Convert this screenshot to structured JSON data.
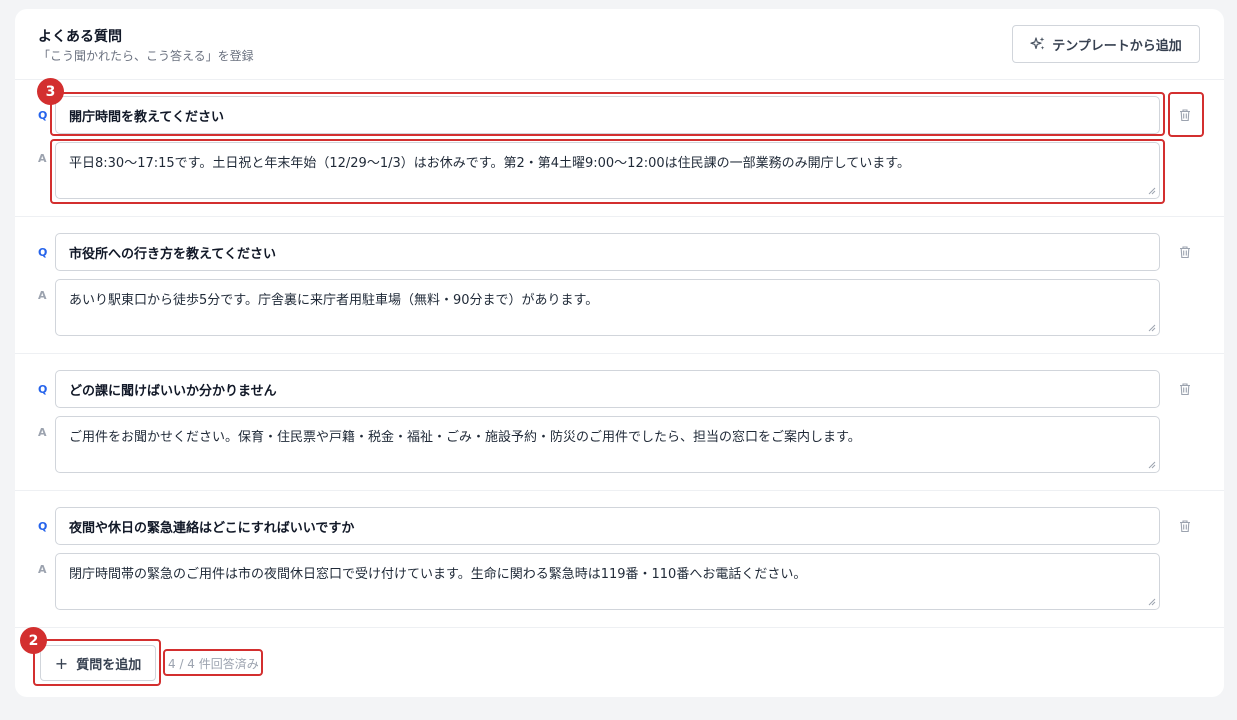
{
  "header": {
    "title": "よくある質問",
    "subtitle": "「こう聞かれたら、こう答える」を登録",
    "template_button": "テンプレートから追加"
  },
  "labels": {
    "q": "Q",
    "a": "A"
  },
  "faq": [
    {
      "question": "開庁時間を教えてください",
      "answer": "平日8:30〜17:15です。土日祝と年末年始（12/29〜1/3）はお休みです。第2・第4土曜9:00〜12:00は住民課の一部業務のみ開庁しています。"
    },
    {
      "question": "市役所への行き方を教えてください",
      "answer": "あいり駅東口から徒歩5分です。庁舎裏に来庁者用駐車場（無料・90分まで）があります。"
    },
    {
      "question": "どの課に聞けばいいか分かりません",
      "answer": "ご用件をお聞かせください。保育・住民票や戸籍・税金・福祉・ごみ・施設予約・防災のご用件でしたら、担当の窓口をご案内します。"
    },
    {
      "question": "夜間や休日の緊急連絡はどこにすればいいですか",
      "answer": "閉庁時間帯の緊急のご用件は市の夜間休日窓口で受け付けています。生命に関わる緊急時は119番・110番へお電話ください。"
    }
  ],
  "footer": {
    "add_button": "質問を追加",
    "answered_count": "4 / 4 件回答済み"
  },
  "annotations": {
    "badge_top": "3",
    "badge_bottom": "2"
  },
  "icons": {
    "template": "sparkle-icon",
    "trash": "trash-icon",
    "plus": "plus-icon"
  },
  "colors": {
    "accent_q": "#2563eb",
    "highlight": "#d32f2f"
  }
}
